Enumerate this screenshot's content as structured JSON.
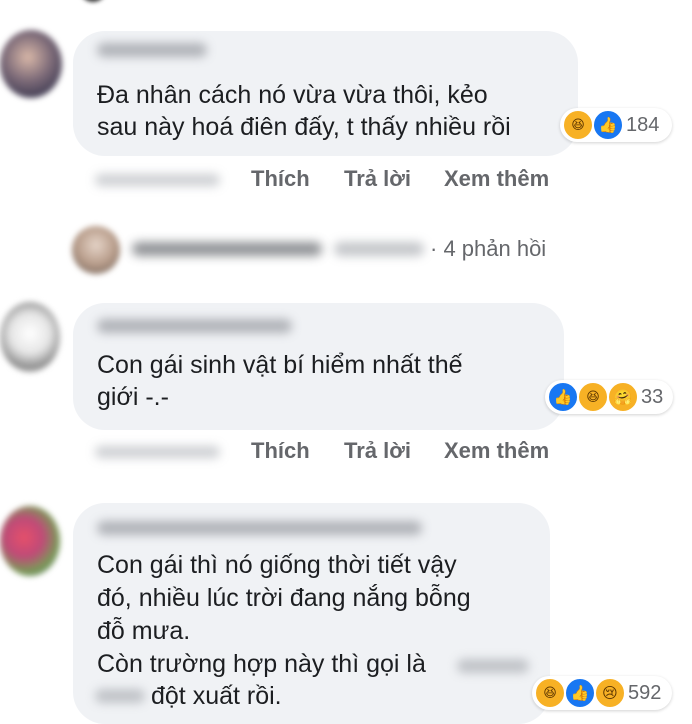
{
  "comments": [
    {
      "lines": [
        "Đa nhân cách nó vừa vừa thôi, kẻo",
        "sau này hoá điên đấy, t thấy nhiều rồi"
      ],
      "reaction_count": "184"
    },
    {
      "lines": [
        "Con gái sinh vật bí hiểm nhất thế",
        "giới -.-"
      ],
      "reaction_count": "33"
    },
    {
      "lines": [
        "Con gái thì nó giống thời tiết vậy",
        "đó, nhiều lúc trời đang nắng bỗng",
        "đỗ mưa.",
        "Còn trường hợp này thì gọi là",
        "đột xuất rồi."
      ],
      "reaction_count": "592"
    }
  ],
  "actions": {
    "like": "Thích",
    "reply": "Trả lời",
    "more": "Xem thêm"
  },
  "reply_summary": {
    "text": "· 4 phản hồi"
  },
  "colors": {
    "bubble": "#f0f2f5",
    "action_text": "#65676b",
    "like_blue": "#1877f2",
    "emoji_yellow": "#f7b125"
  },
  "icons": [
    "like-reaction-icon",
    "haha-reaction-icon",
    "care-reaction-icon",
    "sad-reaction-icon"
  ]
}
